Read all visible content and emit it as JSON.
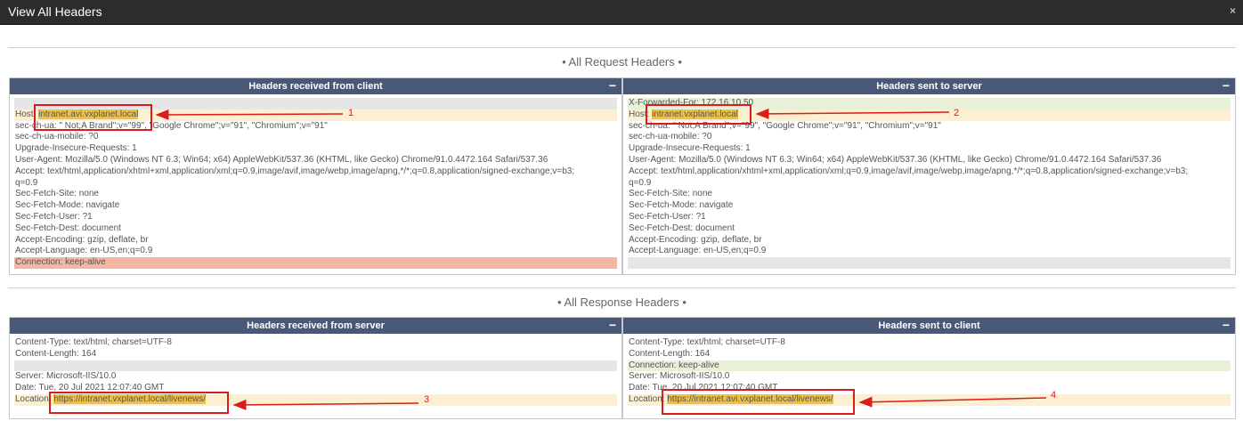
{
  "window": {
    "title": "View All Headers",
    "close_label": "×"
  },
  "request_section_title": "• All Request Headers •",
  "response_section_title": "• All Response Headers •",
  "panels": {
    "req_client": {
      "title": "Headers received from client",
      "collapse": "−",
      "lines": [
        {
          "style": "gray",
          "key": "",
          "value": ""
        },
        {
          "style": "yellow",
          "key": "Host: ",
          "value": "intranet.avi.vxplanet.local",
          "hl": true
        },
        {
          "style": "",
          "key": "",
          "value": "sec-ch-ua: \" Not;A Brand\";v=\"99\", \"Google Chrome\";v=\"91\", \"Chromium\";v=\"91\""
        },
        {
          "style": "",
          "key": "",
          "value": "sec-ch-ua-mobile: ?0"
        },
        {
          "style": "",
          "key": "",
          "value": "Upgrade-Insecure-Requests: 1"
        },
        {
          "style": "",
          "key": "",
          "value": "User-Agent: Mozilla/5.0 (Windows NT 6.3; Win64; x64) AppleWebKit/537.36 (KHTML, like Gecko) Chrome/91.0.4472.164 Safari/537.36"
        },
        {
          "style": "",
          "key": "",
          "value": "Accept: text/html,application/xhtml+xml,application/xml;q=0.9,image/avif,image/webp,image/apng,*/*;q=0.8,application/signed-exchange;v=b3;"
        },
        {
          "style": "",
          "key": "",
          "value": "q=0.9"
        },
        {
          "style": "",
          "key": "",
          "value": "Sec-Fetch-Site: none"
        },
        {
          "style": "",
          "key": "",
          "value": "Sec-Fetch-Mode: navigate"
        },
        {
          "style": "",
          "key": "",
          "value": "Sec-Fetch-User: ?1"
        },
        {
          "style": "",
          "key": "",
          "value": "Sec-Fetch-Dest: document"
        },
        {
          "style": "",
          "key": "",
          "value": "Accept-Encoding: gzip, deflate, br"
        },
        {
          "style": "",
          "key": "",
          "value": "Accept-Language: en-US,en;q=0.9"
        },
        {
          "style": "red",
          "key": "",
          "value": "Connection: keep-alive"
        }
      ]
    },
    "req_server": {
      "title": "Headers sent to server",
      "collapse": "−",
      "lines": [
        {
          "style": "green",
          "key": "",
          "value": "X-Forwarded-For: 172.16.10.50"
        },
        {
          "style": "yellow",
          "key": "Host: ",
          "value": "intranet.vxplanet.local",
          "hl": true
        },
        {
          "style": "",
          "key": "",
          "value": "sec-ch-ua: \" Not;A Brand\";v=\"99\", \"Google Chrome\";v=\"91\", \"Chromium\";v=\"91\""
        },
        {
          "style": "",
          "key": "",
          "value": "sec-ch-ua-mobile: ?0"
        },
        {
          "style": "",
          "key": "",
          "value": "Upgrade-Insecure-Requests: 1"
        },
        {
          "style": "",
          "key": "",
          "value": "User-Agent: Mozilla/5.0 (Windows NT 6.3; Win64; x64) AppleWebKit/537.36 (KHTML, like Gecko) Chrome/91.0.4472.164 Safari/537.36"
        },
        {
          "style": "",
          "key": "",
          "value": "Accept: text/html,application/xhtml+xml,application/xml;q=0.9,image/avif,image/webp,image/apng,*/*;q=0.8,application/signed-exchange;v=b3;"
        },
        {
          "style": "",
          "key": "",
          "value": "q=0.9"
        },
        {
          "style": "",
          "key": "",
          "value": "Sec-Fetch-Site: none"
        },
        {
          "style": "",
          "key": "",
          "value": "Sec-Fetch-Mode: navigate"
        },
        {
          "style": "",
          "key": "",
          "value": "Sec-Fetch-User: ?1"
        },
        {
          "style": "",
          "key": "",
          "value": "Sec-Fetch-Dest: document"
        },
        {
          "style": "",
          "key": "",
          "value": "Accept-Encoding: gzip, deflate, br"
        },
        {
          "style": "",
          "key": "",
          "value": "Accept-Language: en-US,en;q=0.9"
        },
        {
          "style": "gray",
          "key": "",
          "value": ""
        }
      ]
    },
    "resp_server": {
      "title": "Headers received from server",
      "collapse": "−",
      "lines": [
        {
          "style": "",
          "key": "",
          "value": "Content-Type: text/html; charset=UTF-8"
        },
        {
          "style": "",
          "key": "",
          "value": "Content-Length: 164"
        },
        {
          "style": "gray",
          "key": "",
          "value": ""
        },
        {
          "style": "",
          "key": "",
          "value": "Server: Microsoft-IIS/10.0"
        },
        {
          "style": "",
          "key": "",
          "value": "Date: Tue, 20 Jul 2021 12:07:40 GMT"
        },
        {
          "style": "yellow",
          "key": "Location: ",
          "value": "https://intranet.vxplanet.local/livenews/",
          "hl": true
        }
      ]
    },
    "resp_client": {
      "title": "Headers sent to client",
      "collapse": "−",
      "lines": [
        {
          "style": "",
          "key": "",
          "value": "Content-Type: text/html; charset=UTF-8"
        },
        {
          "style": "",
          "key": "",
          "value": "Content-Length: 164"
        },
        {
          "style": "green",
          "key": "",
          "value": "Connection: keep-alive"
        },
        {
          "style": "",
          "key": "",
          "value": "Server: Microsoft-IIS/10.0"
        },
        {
          "style": "",
          "key": "",
          "value": "Date: Tue, 20 Jul 2021 12:07:40 GMT"
        },
        {
          "style": "yellow",
          "key": "Location: ",
          "value": "https://intranet.avi.vxplanet.local/livenews/",
          "hl": true
        }
      ]
    }
  },
  "annotations": [
    "1",
    "2",
    "3",
    "4"
  ],
  "colors": {
    "titlebar": "#2c2c2c",
    "panel_header": "#4a5878",
    "annotation": "#d91c1c",
    "highlight": "#f0c040"
  }
}
